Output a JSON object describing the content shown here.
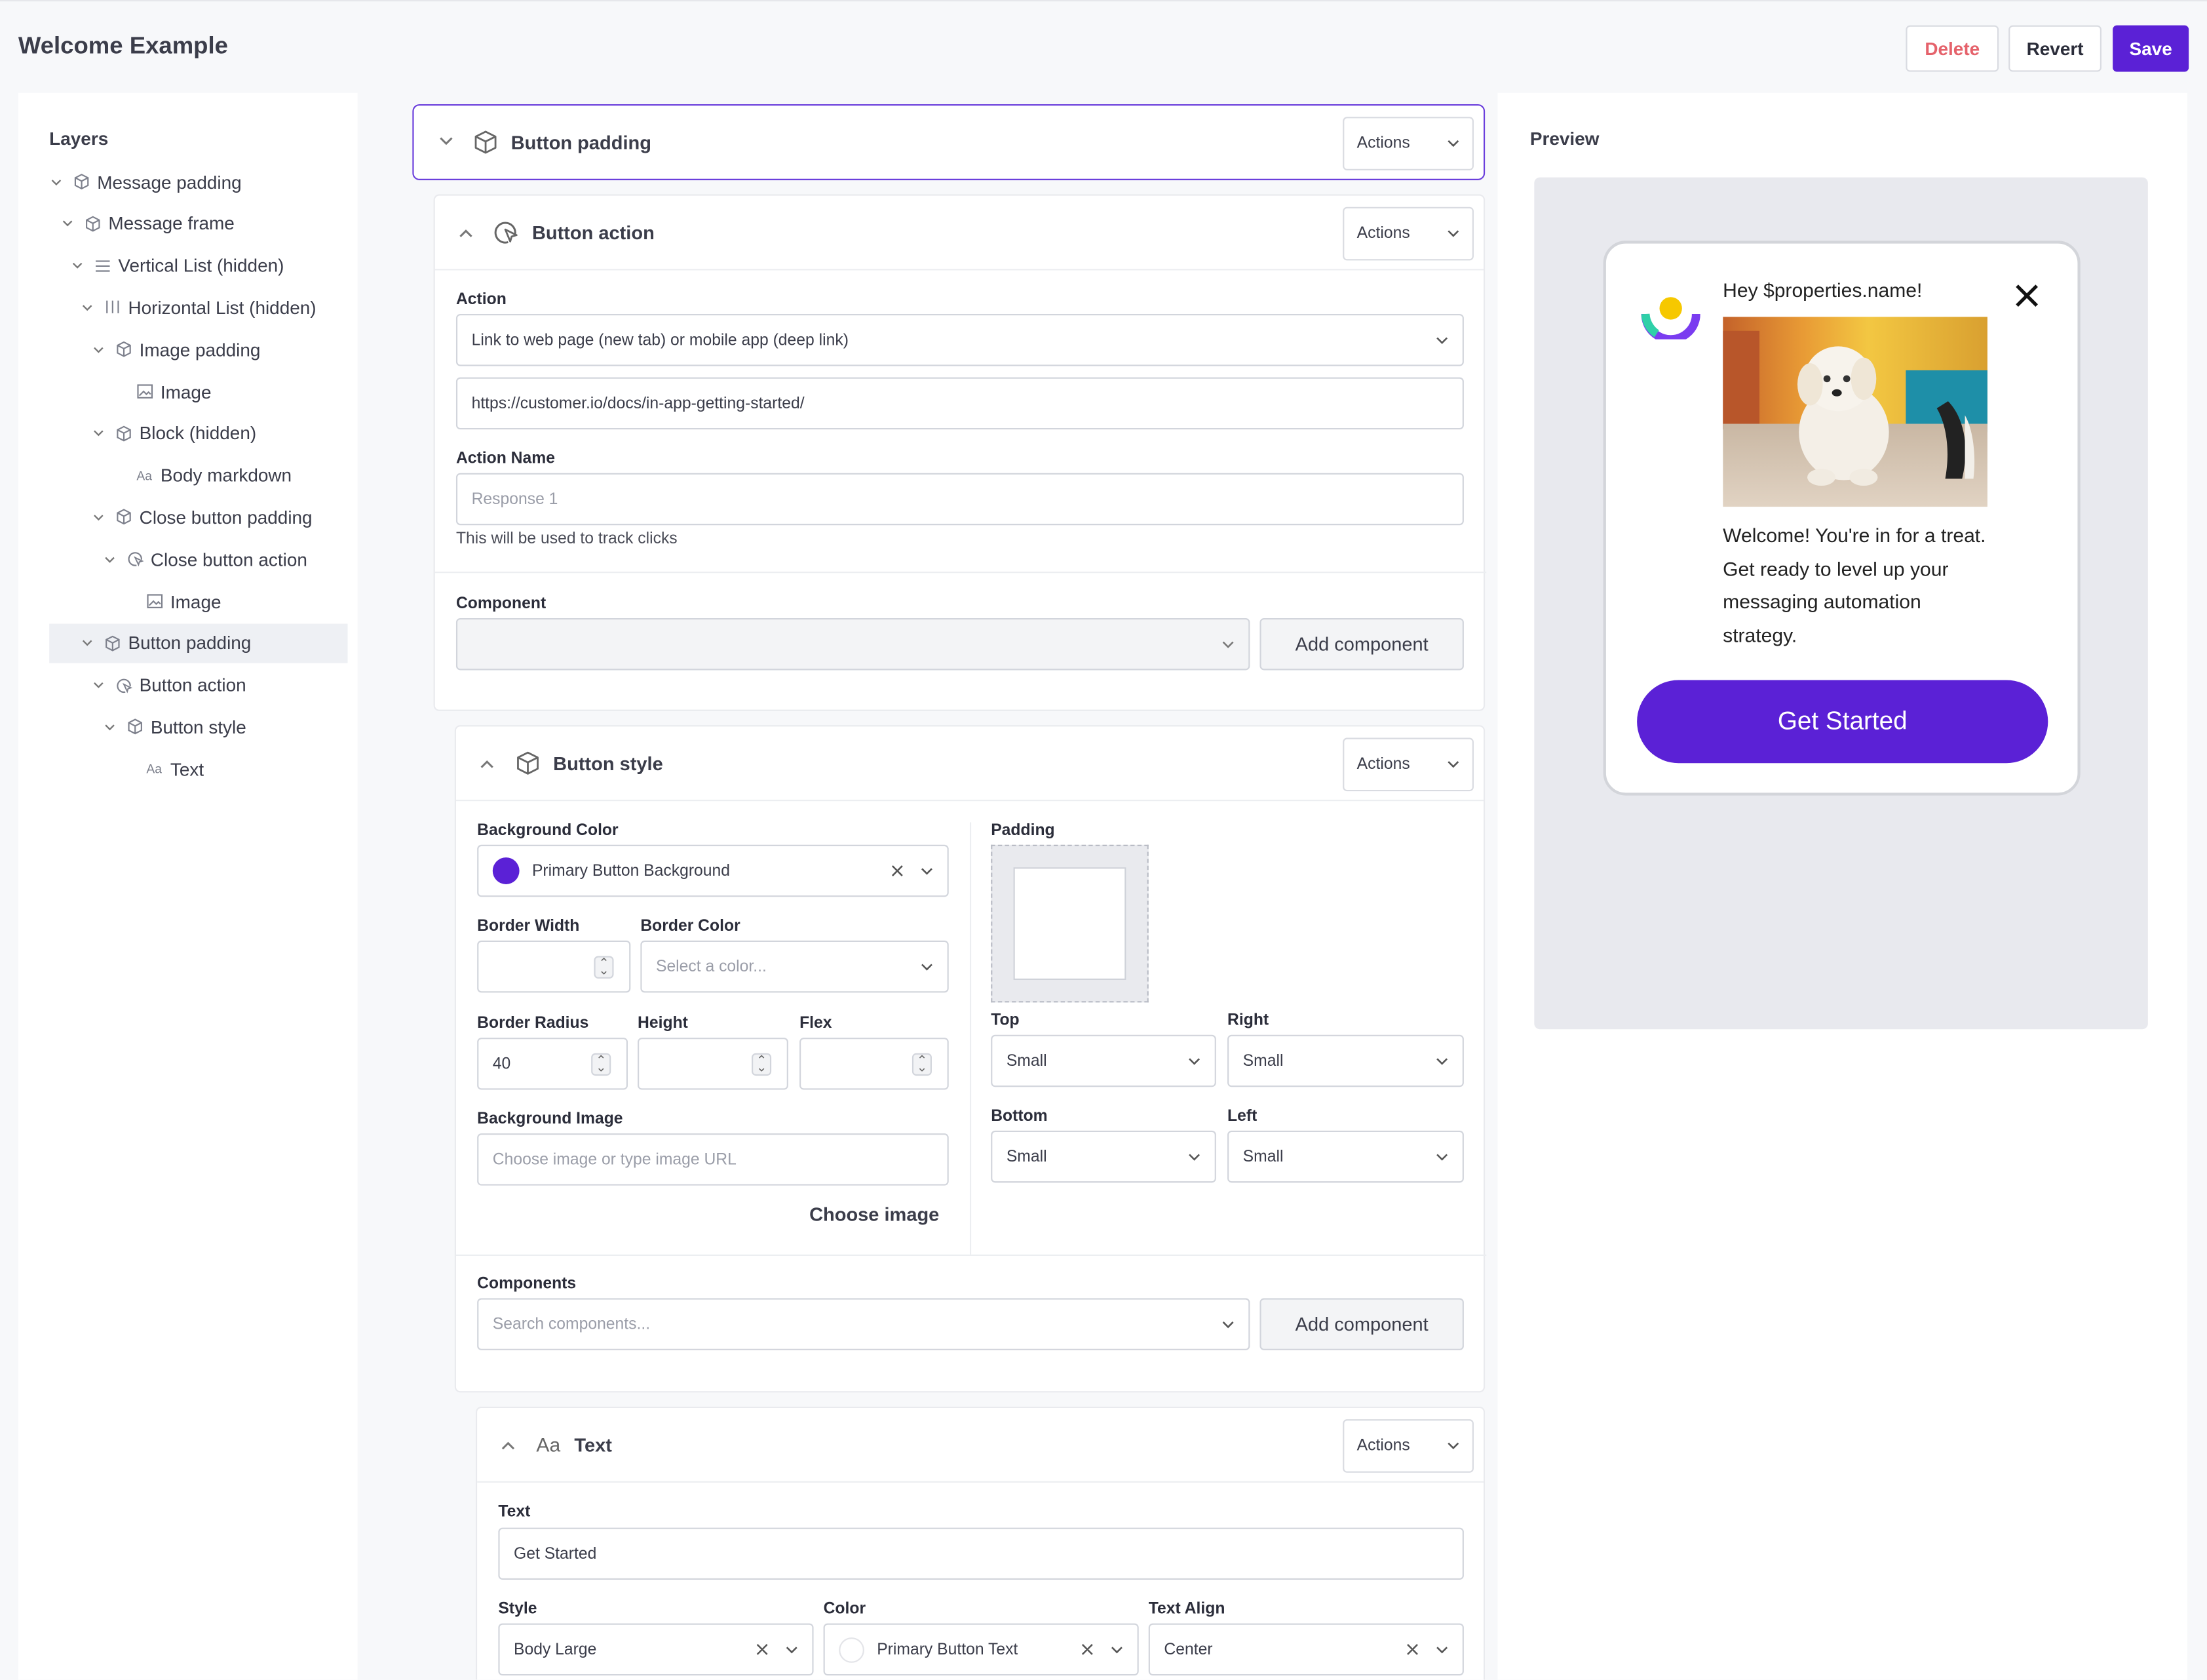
{
  "header": {
    "title": "Welcome Example",
    "delete_label": "Delete",
    "revert_label": "Revert",
    "save_label": "Save"
  },
  "layers": {
    "title": "Layers",
    "items": [
      {
        "label": "Message padding",
        "icon": "cube-icon"
      },
      {
        "label": "Message frame",
        "icon": "cube-icon"
      },
      {
        "label": "Vertical List (hidden)",
        "icon": "list-icon"
      },
      {
        "label": "Horizontal List (hidden)",
        "icon": "columns-icon"
      },
      {
        "label": "Image padding",
        "icon": "cube-icon"
      },
      {
        "label": "Image",
        "icon": "image-icon"
      },
      {
        "label": "Block (hidden)",
        "icon": "cube-icon"
      },
      {
        "label": "Body markdown",
        "icon": "text-icon"
      },
      {
        "label": "Close button padding",
        "icon": "cube-icon"
      },
      {
        "label": "Close button action",
        "icon": "cursor-click-icon"
      },
      {
        "label": "Image",
        "icon": "image-icon"
      },
      {
        "label": "Button padding",
        "icon": "cube-icon"
      },
      {
        "label": "Button action",
        "icon": "cursor-click-icon"
      },
      {
        "label": "Button style",
        "icon": "cube-icon"
      },
      {
        "label": "Text",
        "icon": "text-icon"
      }
    ]
  },
  "editor": {
    "actions_label": "Actions",
    "button_padding": {
      "title": "Button padding"
    },
    "button_action": {
      "title": "Button action",
      "action_label": "Action",
      "action_value": "Link to web page (new tab) or mobile app (deep link)",
      "url_value": "https://customer.io/docs/in-app-getting-started/",
      "action_name_label": "Action Name",
      "action_name_placeholder": "Response 1",
      "action_name_hint": "This will be used to track clicks",
      "component_label": "Component",
      "add_component_label": "Add component"
    },
    "button_style": {
      "title": "Button style",
      "background_color_label": "Background Color",
      "background_color_value": "Primary Button Background",
      "background_color_swatch": "#5b21d6",
      "border_width_label": "Border Width",
      "border_color_label": "Border Color",
      "border_color_placeholder": "Select a color...",
      "border_radius_label": "Border Radius",
      "border_radius_value": "40",
      "height_label": "Height",
      "flex_label": "Flex",
      "background_image_label": "Background Image",
      "background_image_placeholder": "Choose image or type image URL",
      "choose_image_label": "Choose image",
      "padding_label": "Padding",
      "top_label": "Top",
      "top_value": "Small",
      "right_label": "Right",
      "right_value": "Small",
      "bottom_label": "Bottom",
      "bottom_value": "Small",
      "left_label": "Left",
      "left_value": "Small",
      "components_label": "Components",
      "components_placeholder": "Search components...",
      "add_component_label": "Add component"
    },
    "text": {
      "title": "Text",
      "text_label": "Text",
      "text_value": "Get Started",
      "style_label": "Style",
      "style_value": "Body Large",
      "color_label": "Color",
      "color_value": "Primary Button Text",
      "text_align_label": "Text Align",
      "text_align_value": "Center"
    }
  },
  "preview": {
    "title": "Preview",
    "greeting": "Hey $properties.name!",
    "body_lines": [
      "Welcome! You're in for a treat.",
      "Get ready to level up your",
      "messaging automation",
      "strategy."
    ],
    "cta_label": "Get Started",
    "accent_color": "#5b21d6"
  }
}
